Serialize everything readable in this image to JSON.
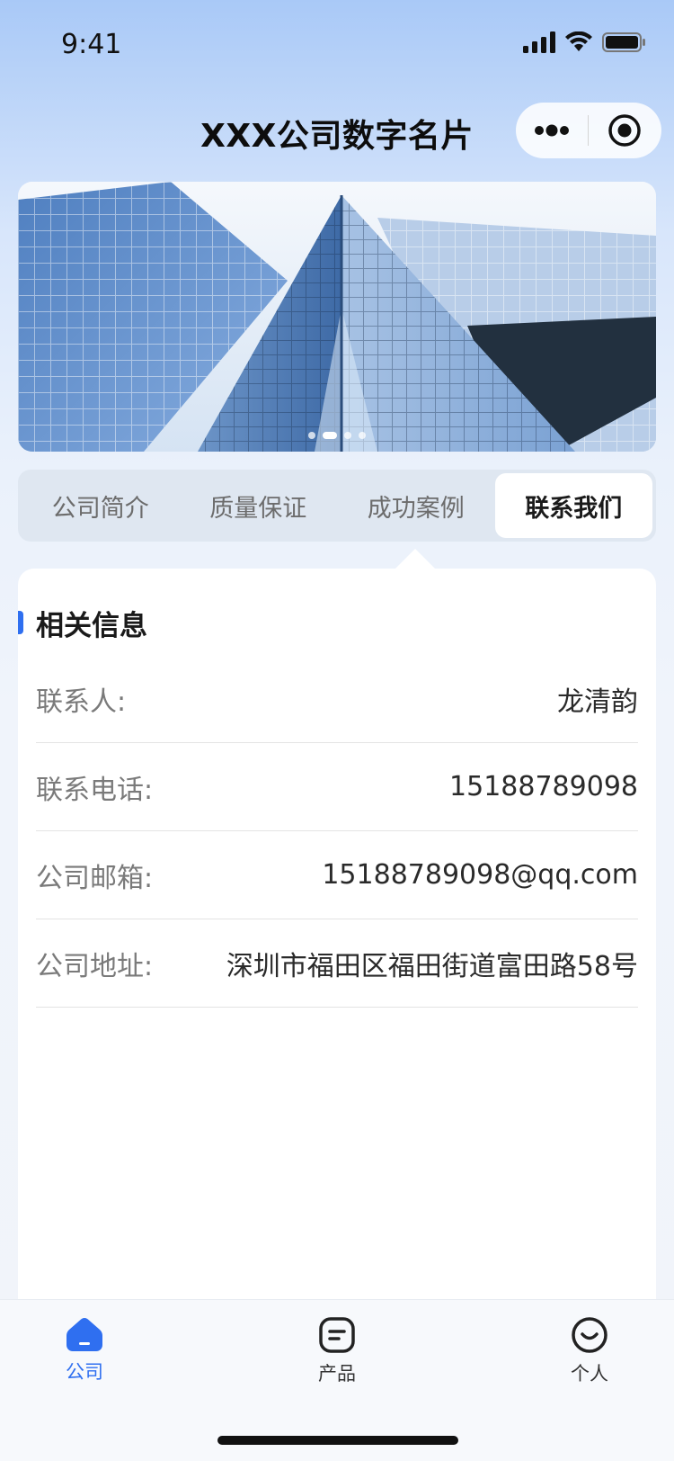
{
  "status_bar": {
    "time": "9:41",
    "icons": [
      "signal-icon",
      "wifi-icon",
      "battery-icon"
    ]
  },
  "header": {
    "title": "XXX公司数字名片",
    "capsule_icons": [
      "more-icon",
      "close-target-icon"
    ]
  },
  "banner": {
    "image": "office-building-photo",
    "dots": 4,
    "active_dot": 1
  },
  "tabs": [
    {
      "label": "公司简介",
      "active": false
    },
    {
      "label": "质量保证",
      "active": false
    },
    {
      "label": "成功案例",
      "active": false
    },
    {
      "label": "联系我们",
      "active": true
    }
  ],
  "section": {
    "title": "相关信息"
  },
  "contact": [
    {
      "label": "联系人:",
      "value": "龙清韵"
    },
    {
      "label": "联系电话:",
      "value": "15188789098"
    },
    {
      "label": "公司邮箱:",
      "value": "15188789098@qq.com"
    },
    {
      "label": "公司地址:",
      "value": "深圳市福田区福田街道富田路58号"
    }
  ],
  "tabbar": [
    {
      "label": "公司",
      "icon": "home-icon",
      "active": true
    },
    {
      "label": "产品",
      "icon": "message-icon",
      "active": false
    },
    {
      "label": "个人",
      "icon": "smile-icon",
      "active": false
    }
  ],
  "colors": {
    "accent": "#2f6ff0",
    "background_top": "#a9c9f7",
    "background": "#f1f4fa"
  }
}
